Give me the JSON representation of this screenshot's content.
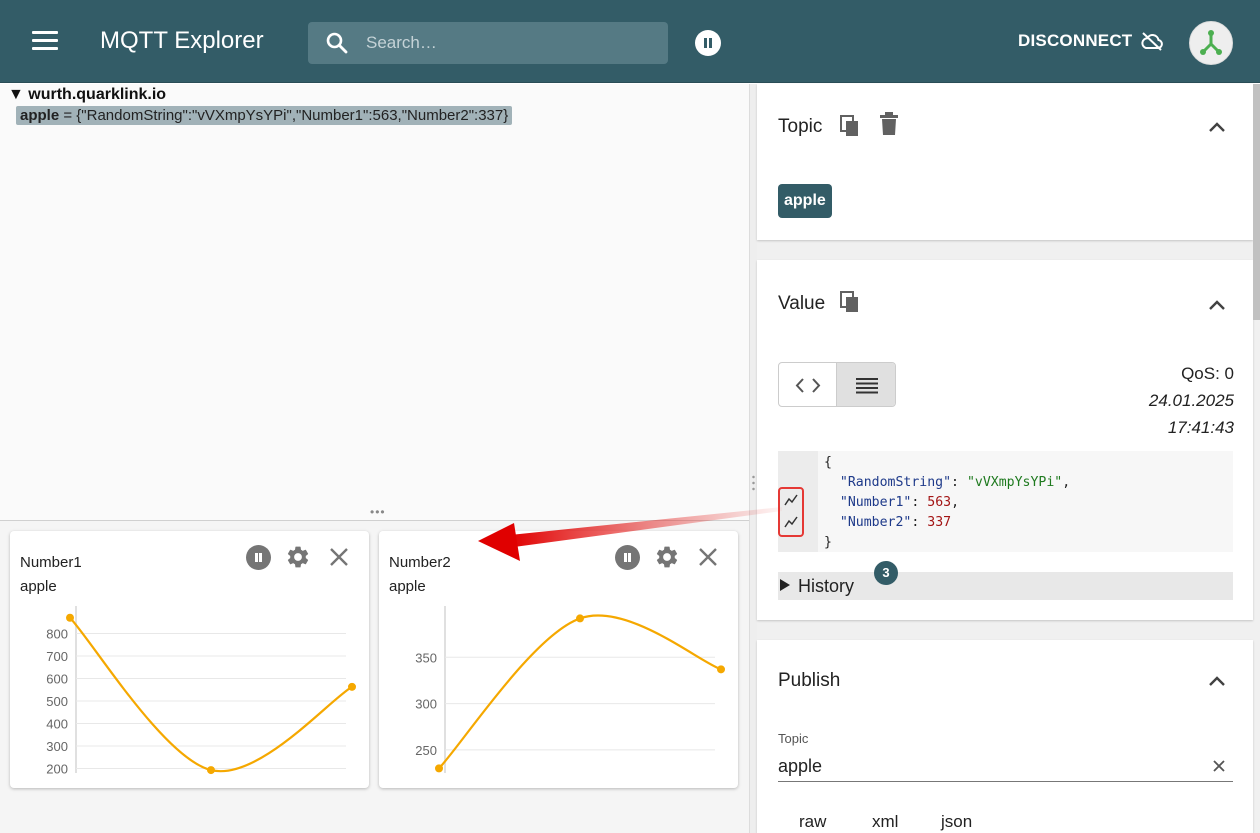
{
  "app": {
    "title": "MQTT Explorer",
    "search_placeholder": "Search…",
    "disconnect_label": "DISCONNECT"
  },
  "tree": {
    "root": "▼ wurth.quarklink.io",
    "node_name": "apple",
    "node_value": " = {\"RandomString\":\"vVXmpYsYPi\",\"Number1\":563,\"Number2\":337}"
  },
  "charts": [
    {
      "title": "Number1",
      "subtitle": "apple"
    },
    {
      "title": "Number2",
      "subtitle": "apple"
    }
  ],
  "chart_data": [
    {
      "type": "line",
      "title": "Number1",
      "subtitle": "apple",
      "x": [
        0,
        1,
        2
      ],
      "values": [
        870,
        193,
        563
      ],
      "yticks": [
        200,
        300,
        400,
        500,
        600,
        700,
        800
      ],
      "ylim": [
        180,
        900
      ],
      "color": "#f5a800",
      "grid": true
    },
    {
      "type": "line",
      "title": "Number2",
      "subtitle": "apple",
      "x": [
        0,
        1,
        2
      ],
      "values": [
        230,
        392,
        337
      ],
      "yticks": [
        250,
        300,
        350
      ],
      "ylim": [
        225,
        400
      ],
      "color": "#f5a800",
      "grid": true
    }
  ],
  "topic_section": {
    "title": "Topic",
    "chip": "apple"
  },
  "value_section": {
    "title": "Value",
    "qos": "QoS: 0",
    "date": "24.01.2025",
    "time": "17:41:43",
    "json": {
      "open": "{",
      "k1": "\"RandomString\"",
      "v1": "\"vVXmpYsYPi\"",
      "k2": "\"Number1\"",
      "v2": "563",
      "k3": "\"Number2\"",
      "v3": "337",
      "close": "}"
    },
    "history_label": "History",
    "history_count": "3"
  },
  "publish_section": {
    "title": "Publish",
    "topic_label": "Topic",
    "topic_value": "apple",
    "formats": [
      "raw",
      "xml",
      "json"
    ]
  },
  "colors": {
    "primary": "#335c67",
    "chart_line": "#f5a800",
    "annotation": "#e53935"
  }
}
